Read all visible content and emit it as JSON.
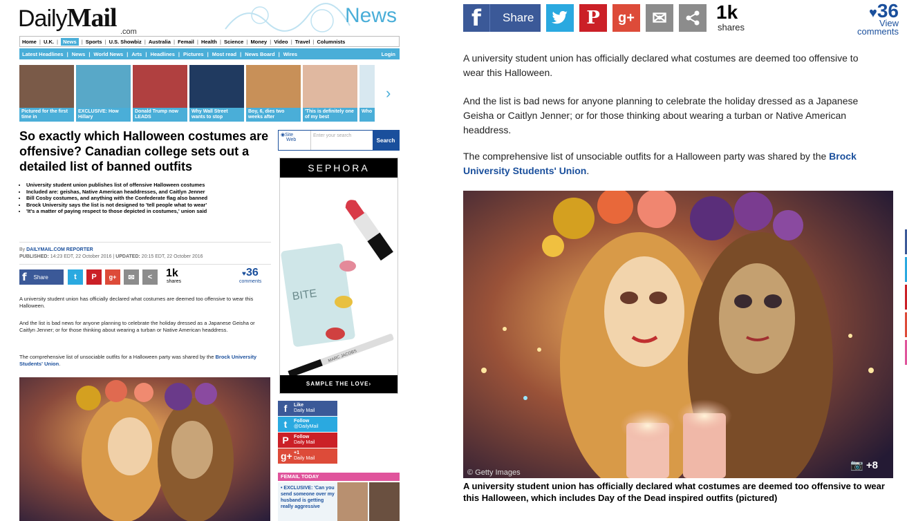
{
  "masthead": {
    "logo_daily": "Daily",
    "logo_mail": "Mail",
    "logo_sub": ".com",
    "section": "News"
  },
  "nav_primary": [
    "Home",
    "U.K.",
    "News",
    "Sports",
    "U.S. Showbiz",
    "Australia",
    "Femail",
    "Health",
    "Science",
    "Money",
    "Video",
    "Travel",
    "Columnists"
  ],
  "nav_primary_active": "News",
  "nav_secondary": [
    "Latest Headlines",
    "News",
    "World News",
    "Arts",
    "Headlines",
    "Pictures",
    "Most read",
    "News Board",
    "Wires"
  ],
  "nav_login": "Login",
  "carousel": [
    {
      "caption": "Pictured for the first time in"
    },
    {
      "caption": "EXCLUSIVE: How Hillary"
    },
    {
      "caption": "Donald Trump now LEADS"
    },
    {
      "caption": "Why Wall Street wants to stop"
    },
    {
      "caption": "Boy, 6, dies two weeks after"
    },
    {
      "caption": "'This is definitely one of my best"
    },
    {
      "caption": "Who"
    }
  ],
  "article": {
    "headline": "So exactly which Halloween costumes are offensive? Canadian college sets out a detailed list of banned outfits",
    "bullets": [
      "University student union publishes list of offensive Halloween costumes",
      "Included are: geishas, Native American headdresses, and Caitlyn Jenner",
      "Bill Cosby costumes, and anything with the Confederate flag also banned",
      "Brock University says the list is not designed to 'tell people what to wear'",
      "'It's a matter of paying respect to those depicted in costumes,' union said"
    ],
    "byline_prefix": "By",
    "byline_author": "DAILYMAIL.COM REPORTER",
    "published_label": "PUBLISHED:",
    "published": "14:23 EDT, 22 October 2016",
    "updated_label": "UPDATED:",
    "updated": "20:15 EDT, 22 October 2016",
    "para1": "A university student union has officially declared what costumes are deemed too offensive to wear this Halloween.",
    "para2": "And the list is bad news for anyone planning to celebrate the holiday dressed as a Japanese Geisha or Caitlyn Jenner; or for those thinking about wearing a turban or Native American headdress.",
    "para3_text": "The comprehensive list of unsociable outfits for a Halloween party was shared by the",
    "para3_link": "Brock University Students' Union",
    "para3_end": ".",
    "photo_credit": "© Getty Images",
    "photo_count": "+8",
    "caption": "A university student union has officially declared what costumes are deemed too offensive to wear this Halloween, which includes Day of the Dead inspired outfits (pictured)"
  },
  "share": {
    "facebook_label": "Share",
    "shares_count": "1k",
    "shares_label": "shares",
    "comments_count": "36",
    "comments_view": "View",
    "comments_label": "comments"
  },
  "search": {
    "site_label": "Site",
    "web_label": "Web",
    "placeholder": "Enter your search",
    "button": "Search"
  },
  "ad": {
    "brand": "SEPHORA",
    "product_text": "BITE",
    "pencil_text": "MARC JACOBS",
    "cta": "SAMPLE THE LOVE›"
  },
  "follow": [
    {
      "l1": "Like",
      "l2": "Daily Mail",
      "icon": "f",
      "color": "#3b5998"
    },
    {
      "l1": "Follow",
      "l2": "@DailyMail",
      "icon": "t",
      "color": "#2aa9e0"
    },
    {
      "l1": "Follow",
      "l2": "Daily Mail",
      "icon": "P",
      "color": "#cb2027"
    },
    {
      "l1": "+1",
      "l2": "Daily Mail",
      "icon": "g+",
      "color": "#dd4b39"
    }
  ],
  "femail": {
    "title": "FEMAIL TODAY",
    "item": "• EXCLUSIVE: 'Can you send someone over my husband is getting really aggressive"
  },
  "colors": {
    "brand_blue": "#4aaed8",
    "link_blue": "#1a4f9c",
    "facebook": "#3b5998",
    "twitter": "#2aa9e0",
    "pinterest": "#cb2027",
    "googleplus": "#dd4b39",
    "email": "#8c8c8c",
    "share_generic": "#8c8c8c",
    "femail_pink": "#e0549c"
  }
}
